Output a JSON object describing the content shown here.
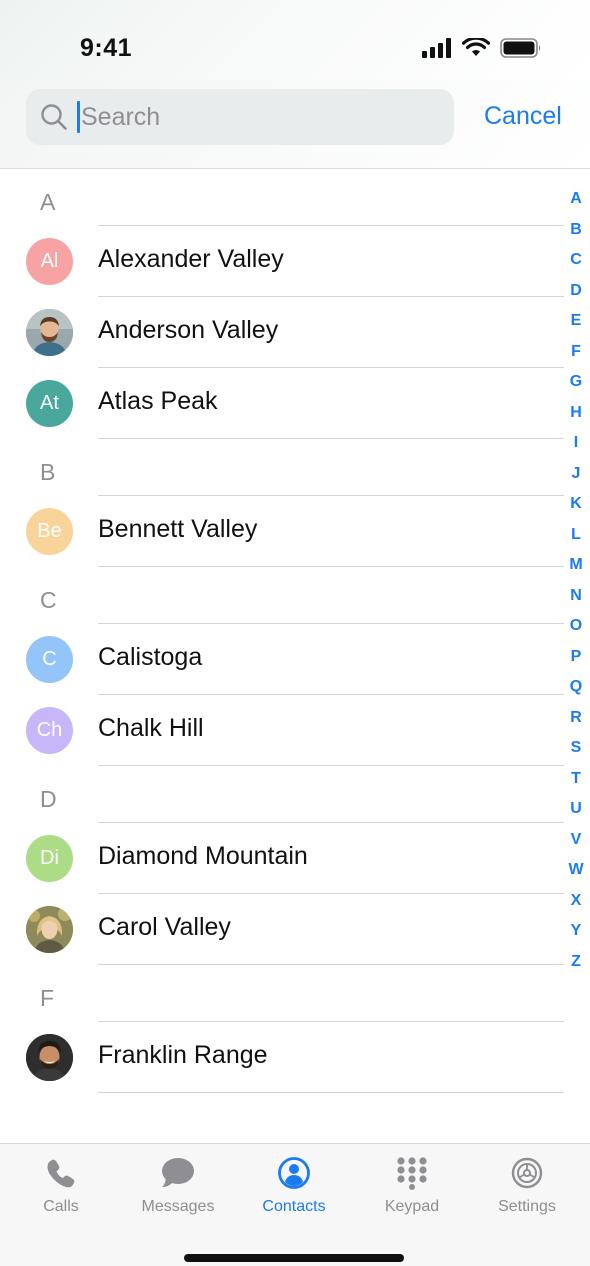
{
  "status": {
    "time": "9:41"
  },
  "search": {
    "placeholder": "Search",
    "value": "",
    "cancel_label": "Cancel"
  },
  "sections": [
    {
      "letter": "A",
      "contacts": [
        {
          "name": "Alexander Valley",
          "initials": "Al",
          "color": "#f8a3a3",
          "photo": false
        },
        {
          "name": "Anderson Valley",
          "initials": "",
          "color": "#6e7f8a",
          "photo": true,
          "photo_icon": "bearded-man-photo"
        },
        {
          "name": "Atlas Peak",
          "initials": "At",
          "color": "#4aa79b",
          "photo": false
        }
      ]
    },
    {
      "letter": "B",
      "contacts": [
        {
          "name": "Bennett Valley",
          "initials": "Be",
          "color": "#f8d49a",
          "photo": false
        }
      ]
    },
    {
      "letter": "C",
      "contacts": [
        {
          "name": "Calistoga",
          "initials": "C",
          "color": "#93c5f8",
          "photo": false
        },
        {
          "name": "Chalk Hill",
          "initials": "Ch",
          "color": "#c7b6f8",
          "photo": false
        }
      ]
    },
    {
      "letter": "D",
      "contacts": [
        {
          "name": "Diamond Mountain",
          "initials": "Di",
          "color": "#addc86",
          "photo": false
        },
        {
          "name": "Carol Valley",
          "initials": "",
          "color": "#a99a6a",
          "photo": true,
          "photo_icon": "woman-photo"
        }
      ]
    },
    {
      "letter": "F",
      "contacts": [
        {
          "name": "Franklin Range",
          "initials": "",
          "color": "#3b3b3b",
          "photo": true,
          "photo_icon": "smiling-man-photo"
        }
      ]
    }
  ],
  "index_letters": [
    "A",
    "B",
    "C",
    "D",
    "E",
    "F",
    "G",
    "H",
    "I",
    "J",
    "K",
    "L",
    "M",
    "N",
    "O",
    "P",
    "Q",
    "R",
    "S",
    "T",
    "U",
    "V",
    "W",
    "X",
    "Y",
    "Z"
  ],
  "tabs": [
    {
      "id": "calls",
      "label": "Calls",
      "icon": "phone-icon",
      "active": false
    },
    {
      "id": "messages",
      "label": "Messages",
      "icon": "chat-bubble-icon",
      "active": false
    },
    {
      "id": "contacts",
      "label": "Contacts",
      "icon": "person-circle-icon",
      "active": true
    },
    {
      "id": "keypad",
      "label": "Keypad",
      "icon": "keypad-icon",
      "active": false
    },
    {
      "id": "settings",
      "label": "Settings",
      "icon": "gear-icon",
      "active": false
    }
  ],
  "colors": {
    "accent": "#1a7cf0",
    "inactive": "#8e8e93"
  }
}
